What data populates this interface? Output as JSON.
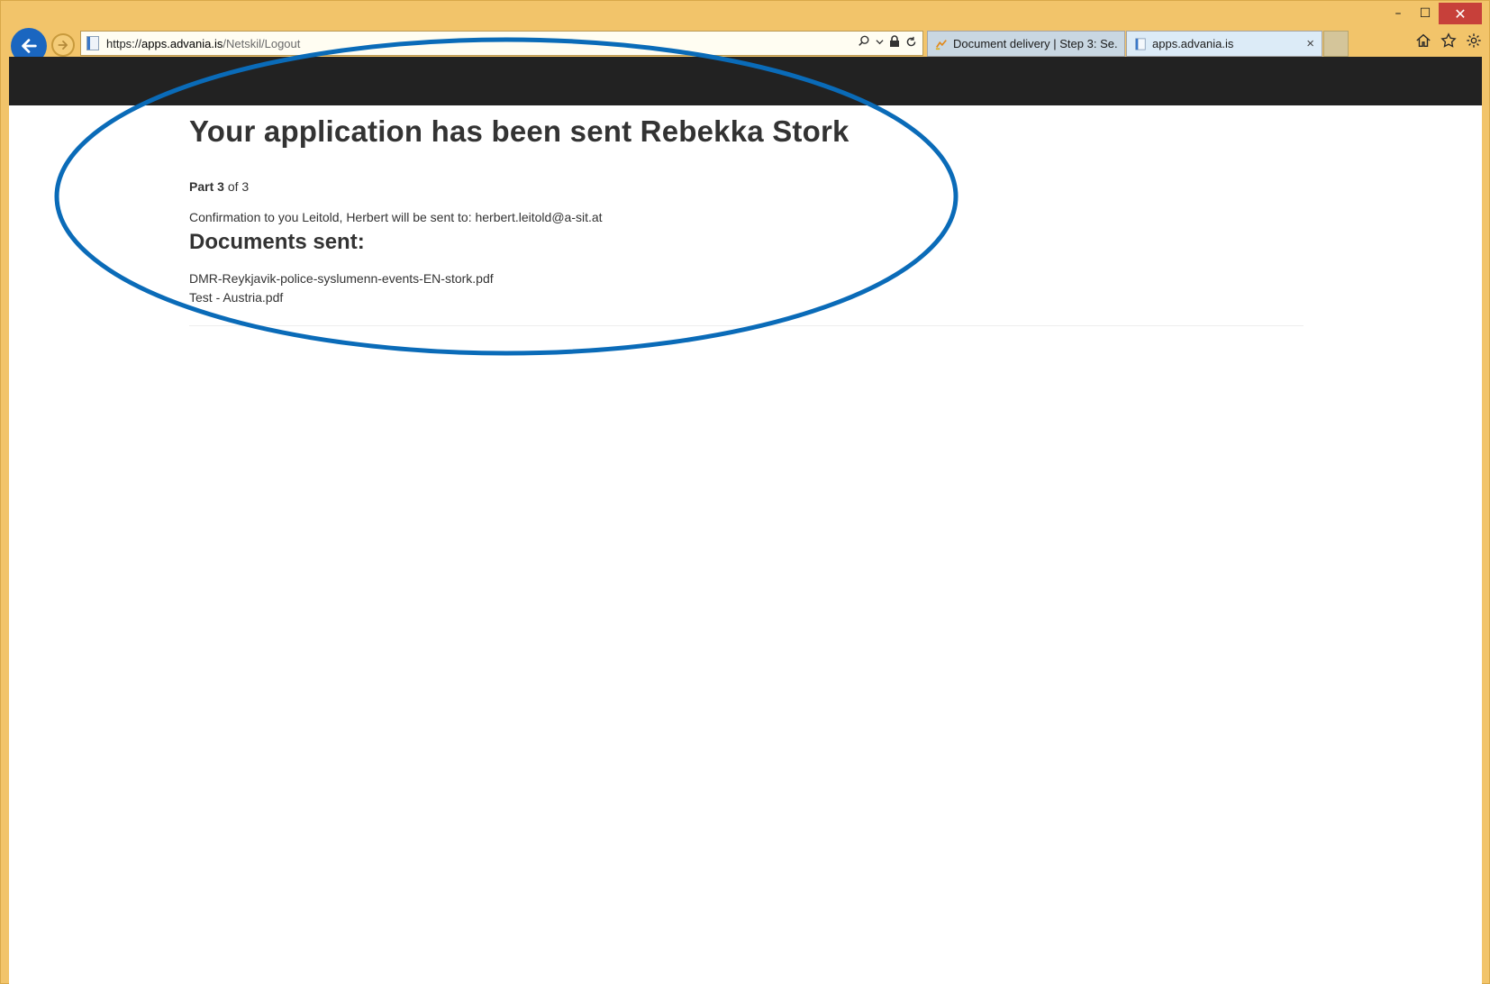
{
  "window": {
    "controls": {
      "minimize": "–",
      "maximize": "☐",
      "close": "✕"
    }
  },
  "address_bar": {
    "url_scheme": "https://",
    "url_host": "apps.advania.is",
    "url_path": "/Netskil/Logout"
  },
  "tabs": [
    {
      "label": "Document delivery | Step 3: Se...",
      "icon": "document-delivery-icon",
      "active": false
    },
    {
      "label": "apps.advania.is",
      "icon": "page-icon",
      "active": true,
      "close": "×"
    }
  ],
  "page": {
    "title": "Your application has been sent Rebekka Stork",
    "part_label": "Part",
    "part_current": "3",
    "part_total_text": "of 3",
    "confirmation": "Confirmation to you Leitold, Herbert will be sent to: herbert.leitold@a-sit.at",
    "documents_heading": "Documents sent:",
    "documents": [
      "DMR-Reykjavik-police-syslumenn-events-EN-stork.pdf",
      "Test - Austria.pdf"
    ]
  },
  "colors": {
    "frame": "#f2c46a",
    "topbar": "#222222",
    "annotation": "#0a6bb8"
  }
}
